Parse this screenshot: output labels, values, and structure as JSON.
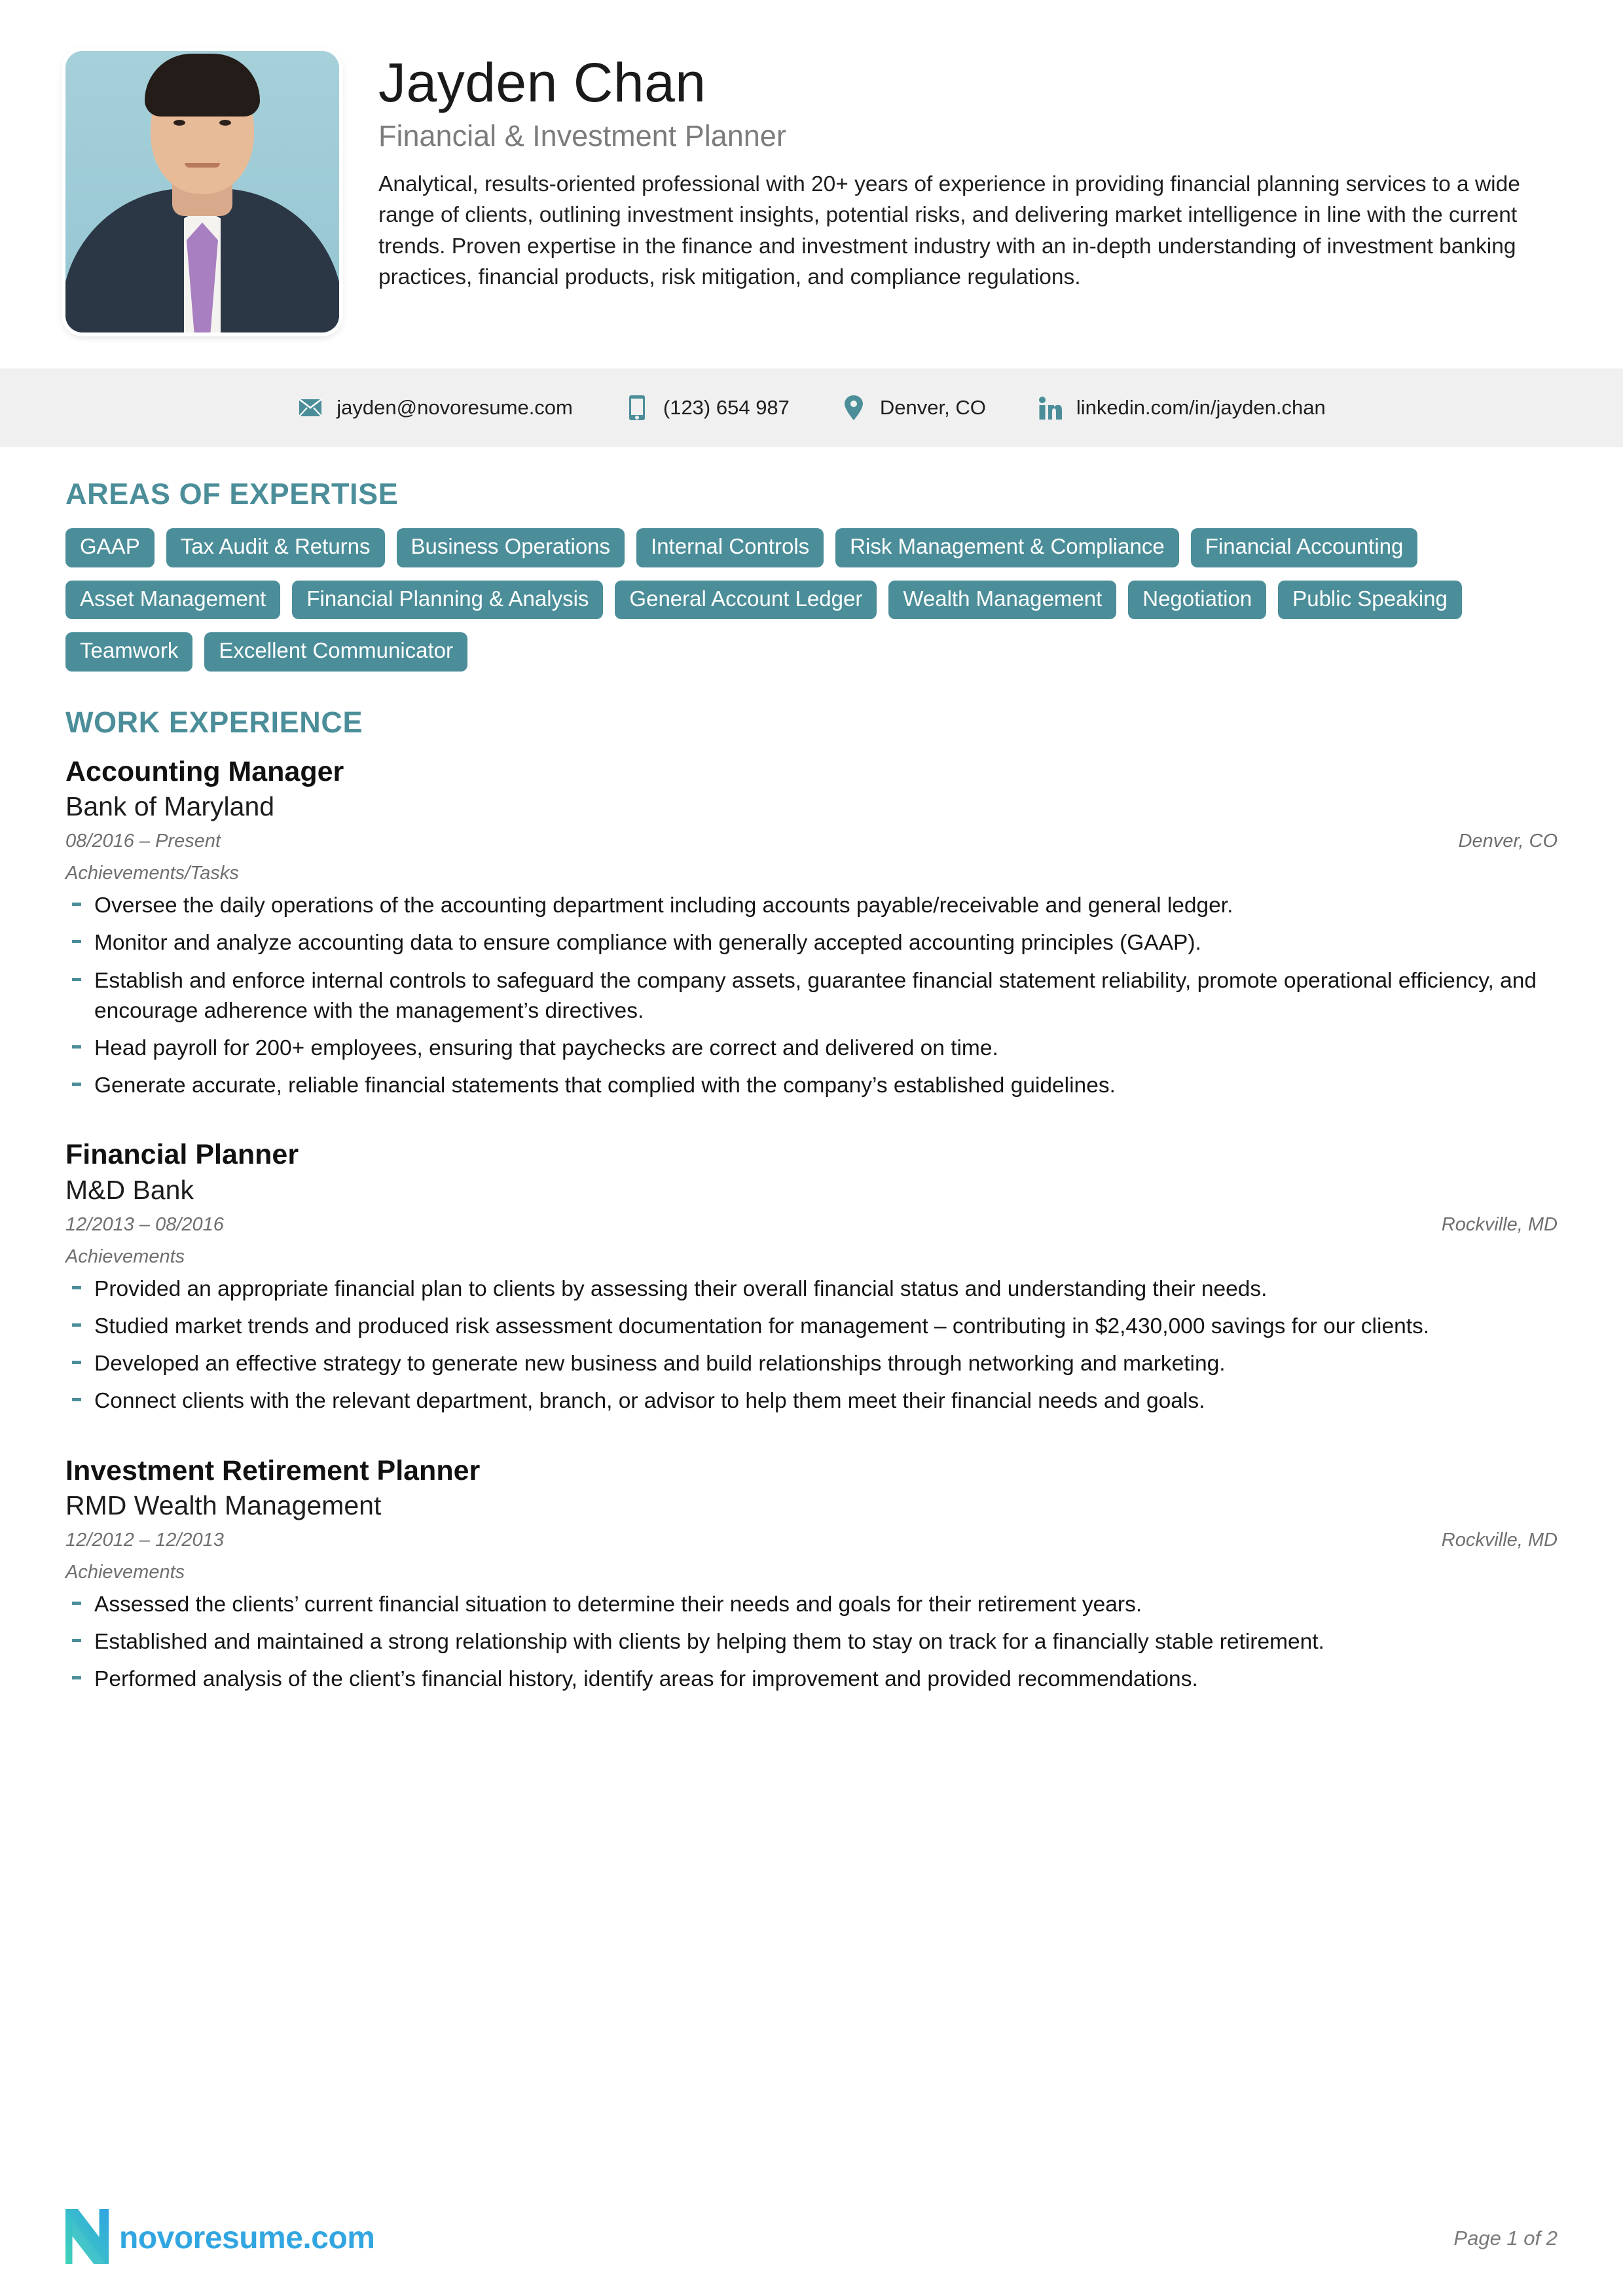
{
  "header": {
    "name": "Jayden Chan",
    "job_title": "Financial & Investment Planner",
    "summary": "Analytical, results-oriented professional with 20+ years of experience in providing financial planning services to a wide range of clients, outlining investment insights, potential risks, and delivering market intelligence in line with the current trends. Proven expertise in the finance and investment industry with an in-depth understanding of investment banking practices, financial products, risk mitigation, and compliance regulations.",
    "photo_alt": "portrait-photo"
  },
  "contact": [
    {
      "icon": "envelope-icon",
      "value": "jayden@novoresume.com"
    },
    {
      "icon": "mobile-phone-icon",
      "value": "(123) 654 987"
    },
    {
      "icon": "location-pin-icon",
      "value": "Denver, CO"
    },
    {
      "icon": "linkedin-icon",
      "value": "linkedin.com/in/jayden.chan"
    }
  ],
  "expertise": {
    "title": "AREAS OF EXPERTISE",
    "tags": [
      "GAAP",
      "Tax Audit & Returns",
      "Business Operations",
      "Internal Controls",
      "Risk Management & Compliance",
      "Financial Accounting",
      "Asset Management",
      "Financial Planning & Analysis",
      "General Account Ledger",
      "Wealth Management",
      "Negotiation",
      "Public Speaking",
      "Teamwork",
      "Excellent Communicator"
    ]
  },
  "experience": {
    "title": "WORK EXPERIENCE",
    "jobs": [
      {
        "role": "Accounting Manager",
        "company": "Bank of Maryland",
        "dates": "08/2016 – Present",
        "location": "Denver, CO",
        "subhead": "Achievements/Tasks",
        "bullets": [
          "Oversee the daily operations of the accounting department including accounts payable/receivable and general ledger.",
          "Monitor and analyze accounting data to ensure compliance with generally accepted accounting principles (GAAP).",
          "Establish and enforce internal controls to safeguard the company assets, guarantee financial statement reliability, promote operational efficiency, and encourage adherence with the management’s directives.",
          "Head payroll for 200+ employees, ensuring that paychecks are correct and delivered on time.",
          "Generate accurate, reliable financial statements that complied with the company’s established guidelines."
        ]
      },
      {
        "role": "Financial Planner",
        "company": "M&D Bank",
        "dates": "12/2013 – 08/2016",
        "location": "Rockville, MD",
        "subhead": "Achievements",
        "bullets": [
          "Provided an appropriate financial plan to clients by assessing their overall financial status and understanding their needs.",
          "Studied market trends and produced risk assessment documentation for management – contributing in $2,430,000 savings for our clients.",
          "Developed an effective strategy to generate new business and build relationships through networking and marketing.",
          "Connect clients with the relevant department, branch, or advisor to help them meet their financial needs and goals."
        ]
      },
      {
        "role": "Investment Retirement Planner",
        "company": "RMD Wealth Management",
        "dates": "12/2012 – 12/2013",
        "location": "Rockville, MD",
        "subhead": "Achievements",
        "bullets": [
          "Assessed the clients’ current financial situation to determine their needs and goals for their retirement years.",
          "Established and maintained a strong relationship with clients by helping them to stay on track for a financially stable retirement.",
          "Performed analysis of the client’s financial history, identify areas for improvement and provided recommendations."
        ]
      }
    ]
  },
  "footer": {
    "logo_text": "novoresume.com",
    "page_label": "Page 1 of 2"
  },
  "colors": {
    "accent_teal": "#4b8e99",
    "contact_bar_bg": "#f0f0f0",
    "muted_text": "#6f6f6f",
    "logo_blue": "#32a6e0",
    "logo_green": "#3fd2b8",
    "photo_bg": "#9ecbd6"
  }
}
